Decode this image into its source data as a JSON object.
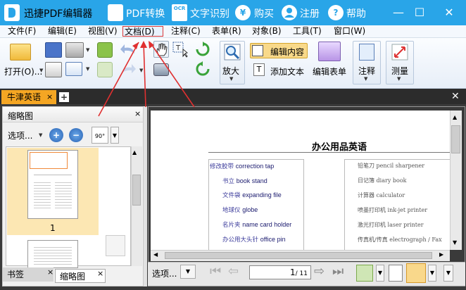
{
  "app": {
    "title": "迅捷PDF编辑器",
    "toolbar_links": [
      {
        "label": "PDF转换",
        "icon": "pdf-convert-icon"
      },
      {
        "label": "文字识别",
        "icon": "ocr-icon"
      },
      {
        "label": "购买",
        "icon": "yen-icon"
      },
      {
        "label": "注册",
        "icon": "user-icon"
      },
      {
        "label": "帮助",
        "icon": "help-icon"
      }
    ],
    "ocr_badge": "OCR",
    "yen_glyph": "¥",
    "help_glyph": "?",
    "window_controls": {
      "minimize": "—",
      "maximize": "☐",
      "close": "✕"
    }
  },
  "menu": [
    "文件(F)",
    "编辑(E)",
    "视图(V)",
    "文档(D)",
    "注释(C)",
    "表单(R)",
    "对象(B)",
    "工具(T)",
    "窗口(W)"
  ],
  "menu_active": "文档(D)",
  "ribbon": {
    "open_label": "打开(O)...",
    "zoom_label": "放大",
    "zoom_value": "90°",
    "edit_content_label": "编辑内容",
    "add_text_label": "添加文本",
    "edit_form_label": "编辑表单",
    "annotate_label": "注释",
    "measure_label": "测量"
  },
  "tabs": {
    "doc_tab": "牛津英语",
    "close_glyph": "×",
    "add_glyph": "+"
  },
  "thumbnail_panel": {
    "title": "缩略图",
    "options_label": "选项...",
    "page_number": "1",
    "bottom_tabs": [
      "书签",
      "缩略图"
    ]
  },
  "document": {
    "heading": "办公用品英语",
    "left_column": [
      {
        "cn": "修改胶带",
        "en": "correction tap"
      },
      {
        "cn": "书立",
        "en": "book stand"
      },
      {
        "cn": "文件袋",
        "en": "expanding file"
      },
      {
        "cn": "地球仪",
        "en": "globe"
      },
      {
        "cn": "名片夹",
        "en": "name card holder"
      },
      {
        "cn": "办公用大头针",
        "en": "office pin"
      }
    ],
    "right_column": [
      {
        "cn": "铅笔刀",
        "en": "pencil sharpener"
      },
      {
        "cn": "日记簿",
        "en": "diary book"
      },
      {
        "cn": "计算器",
        "en": "calculator"
      },
      {
        "cn": "喷墨打印机",
        "en": "ink-jet printer"
      },
      {
        "cn": "激光打印机",
        "en": "laser printer"
      },
      {
        "cn": "传真机/传真",
        "en": "electrograph / Fax"
      }
    ]
  },
  "statusbar": {
    "options_label": "选项...",
    "current_page": "1",
    "total_pages": "/ 11"
  },
  "colors": {
    "titlebar": "#29a5e8",
    "active_tab": "#f5a623",
    "annotation_arrows": "#e03030"
  }
}
